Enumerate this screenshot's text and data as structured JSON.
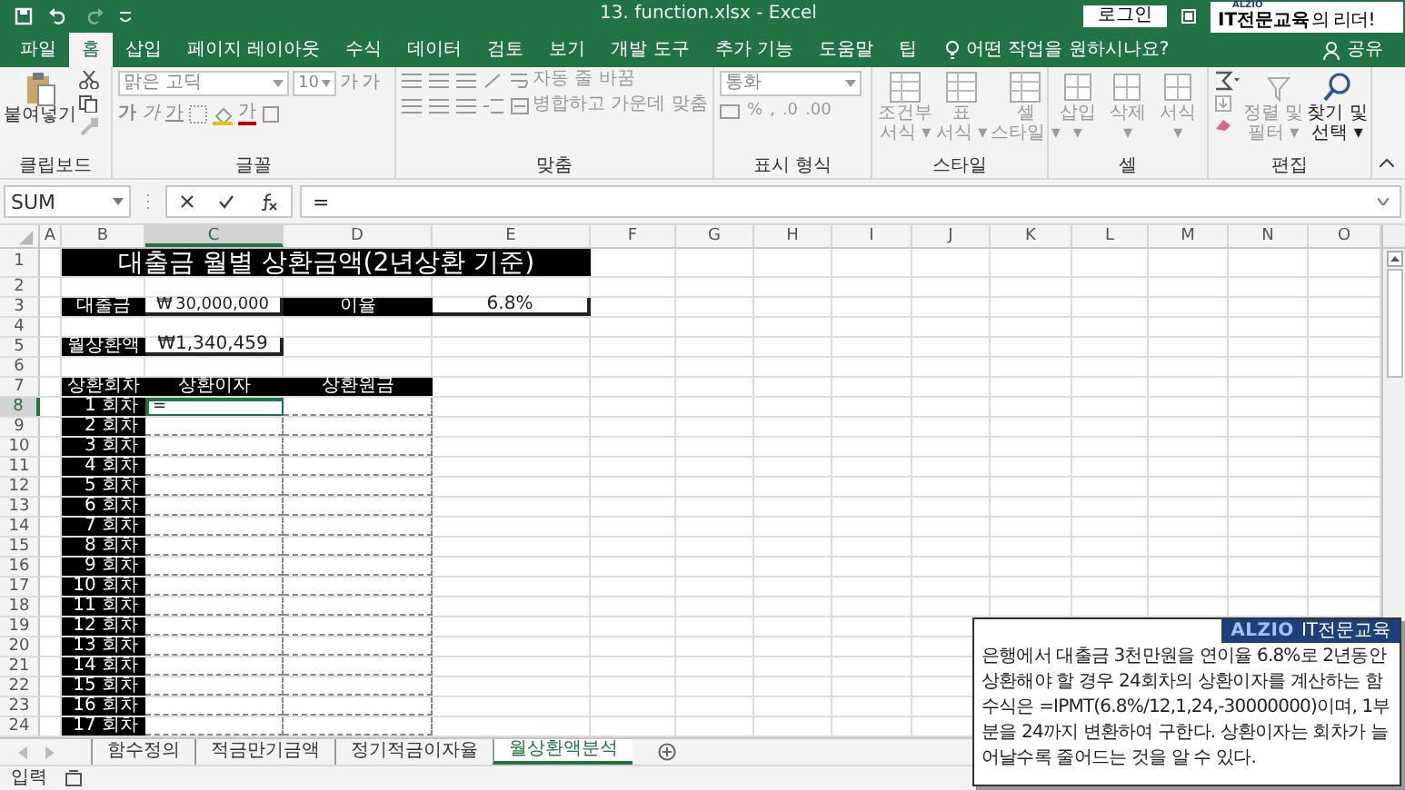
{
  "title_bar": {
    "title": "13. function.xlsx  -  Excel",
    "login": "로그인",
    "logo": {
      "brand": "ALZIO",
      "main": "IT전문교육",
      "suffix": "의 리더!"
    }
  },
  "ribbon_tabs": [
    {
      "label": "파일",
      "selected": false
    },
    {
      "label": "홈",
      "selected": true
    },
    {
      "label": "삽입",
      "selected": false
    },
    {
      "label": "페이지 레이아웃",
      "selected": false
    },
    {
      "label": "수식",
      "selected": false
    },
    {
      "label": "데이터",
      "selected": false
    },
    {
      "label": "검토",
      "selected": false
    },
    {
      "label": "보기",
      "selected": false
    },
    {
      "label": "개발 도구",
      "selected": false
    },
    {
      "label": "추가 기능",
      "selected": false
    },
    {
      "label": "도움말",
      "selected": false
    },
    {
      "label": "팁",
      "selected": false
    }
  ],
  "tell_me": "어떤 작업을 원하시나요?",
  "share": "공유",
  "ribbon": {
    "clipboard": {
      "label": "클립보드",
      "paste": "붙여넣기"
    },
    "font": {
      "label": "글꼴",
      "font_name": "맑은 고딕",
      "font_size": "10",
      "buttons": [
        {
          "glyph": "가",
          "kind": "grow"
        },
        {
          "glyph": "가",
          "kind": "shrink"
        },
        {
          "glyph": "가",
          "kind": "bold"
        },
        {
          "glyph": "가",
          "kind": "italic"
        },
        {
          "glyph": "가",
          "kind": "underline"
        }
      ],
      "font_color": "가"
    },
    "alignment": {
      "label": "맞춤",
      "wrap_text": "자동 줄 바꿈",
      "merge_center": "병합하고 가운데 맞춤"
    },
    "number": {
      "label": "표시 형식",
      "format": "통화",
      "buttons": [
        "%",
        ",",
        ".0",
        ".00"
      ]
    },
    "styles": {
      "label": "스타일",
      "buttons": [
        {
          "label_lines": [
            "조건부",
            "서식 ▾"
          ],
          "disabled": true
        },
        {
          "label_lines": [
            "표",
            "서식 ▾"
          ],
          "disabled": true
        },
        {
          "label_lines": [
            "셀",
            "스타일 ▾"
          ],
          "disabled": true
        }
      ]
    },
    "cells": {
      "label": "셀",
      "buttons": [
        {
          "label_lines": [
            "삽입",
            "▾"
          ],
          "disabled": true
        },
        {
          "label_lines": [
            "삭제",
            "▾"
          ],
          "disabled": true
        },
        {
          "label_lines": [
            "서식",
            "▾"
          ],
          "disabled": true
        }
      ]
    },
    "editing": {
      "label": "편집",
      "buttons": [
        {
          "label_lines": [
            "정렬 및",
            "필터 ▾"
          ],
          "disabled": true
        },
        {
          "label_lines": [
            "찾기 및",
            "선택 ▾"
          ],
          "disabled": false
        }
      ]
    }
  },
  "formula_bar": {
    "name_box": "SUM",
    "formula": "="
  },
  "sheet": {
    "columns": [
      {
        "label": "A",
        "selected": false
      },
      {
        "label": "B",
        "selected": false
      },
      {
        "label": "C",
        "selected": true
      },
      {
        "label": "D",
        "selected": false
      },
      {
        "label": "E",
        "selected": false
      },
      {
        "label": "F",
        "selected": false
      },
      {
        "label": "G",
        "selected": false
      },
      {
        "label": "H",
        "selected": false
      },
      {
        "label": "I",
        "selected": false
      },
      {
        "label": "J",
        "selected": false
      },
      {
        "label": "K",
        "selected": false
      },
      {
        "label": "L",
        "selected": false
      },
      {
        "label": "M",
        "selected": false
      },
      {
        "label": "N",
        "selected": false
      },
      {
        "label": "O",
        "selected": false
      }
    ],
    "row_headers": [
      {
        "label": "1",
        "selected": false
      },
      {
        "label": "2",
        "selected": false
      },
      {
        "label": "3",
        "selected": false
      },
      {
        "label": "4",
        "selected": false
      },
      {
        "label": "5",
        "selected": false
      },
      {
        "label": "6",
        "selected": false
      },
      {
        "label": "7",
        "selected": false
      },
      {
        "label": "8",
        "selected": true
      },
      {
        "label": "9",
        "selected": false
      },
      {
        "label": "10",
        "selected": false
      },
      {
        "label": "11",
        "selected": false
      },
      {
        "label": "12",
        "selected": false
      },
      {
        "label": "13",
        "selected": false
      },
      {
        "label": "14",
        "selected": false
      },
      {
        "label": "15",
        "selected": false
      },
      {
        "label": "16",
        "selected": false
      },
      {
        "label": "17",
        "selected": false
      },
      {
        "label": "18",
        "selected": false
      },
      {
        "label": "19",
        "selected": false
      },
      {
        "label": "20",
        "selected": false
      },
      {
        "label": "21",
        "selected": false
      },
      {
        "label": "22",
        "selected": false
      },
      {
        "label": "23",
        "selected": false
      },
      {
        "label": "24",
        "selected": false
      }
    ],
    "title": "대출금 월별 상환금액(2년상환 기준)",
    "loan": {
      "label": "대출금",
      "currency": "₩",
      "value": "30,000,000"
    },
    "rate": {
      "label": "이율",
      "value": "6.8%"
    },
    "payment": {
      "label": "월상환액",
      "value": "₩1,340,459"
    },
    "table": {
      "columns": [
        "상환회차",
        "상환이자",
        "상환원금"
      ],
      "rows": [
        {
          "period": "1 회차",
          "interest": "=",
          "selected": true
        },
        {
          "period": "2 회차",
          "selected": false
        },
        {
          "period": "3 회차",
          "selected": false
        },
        {
          "period": "4 회차",
          "selected": false
        },
        {
          "period": "5 회차",
          "selected": false
        },
        {
          "period": "6 회차",
          "selected": false
        },
        {
          "period": "7 회차",
          "selected": false
        },
        {
          "period": "8 회차",
          "selected": false
        },
        {
          "period": "9 회차",
          "selected": false
        },
        {
          "period": "10 회차",
          "selected": false
        },
        {
          "period": "11 회차",
          "selected": false
        },
        {
          "period": "12 회차",
          "selected": false
        },
        {
          "period": "13 회차",
          "selected": false
        },
        {
          "period": "14 회차",
          "selected": false
        },
        {
          "period": "15 회차",
          "selected": false
        },
        {
          "period": "16 회차",
          "selected": false
        },
        {
          "period": "17 회차",
          "selected": false
        }
      ]
    }
  },
  "sheet_tabs": [
    {
      "label": "함수정의",
      "selected": false
    },
    {
      "label": "적금만기금액",
      "selected": false
    },
    {
      "label": "정기적금이자율",
      "selected": false
    },
    {
      "label": "월상환액분석",
      "selected": true
    }
  ],
  "status_bar": {
    "mode": "입력"
  },
  "note": {
    "brand": "ALZIO",
    "brand_suffix": "IT전문교육",
    "text": "은행에서 대출금 3천만원을 연이율 6.8%로 2년동안 상환해야 할 경우 24회차의 상환이자를 계산하는 함수식은 =IPMT(6.8%/12,1,24,-30000000)이며, 1부분을 24까지 변환하여 구한다. 상환이자는 회차가 늘어날수록 줄어드는 것을 알 수 있다."
  }
}
